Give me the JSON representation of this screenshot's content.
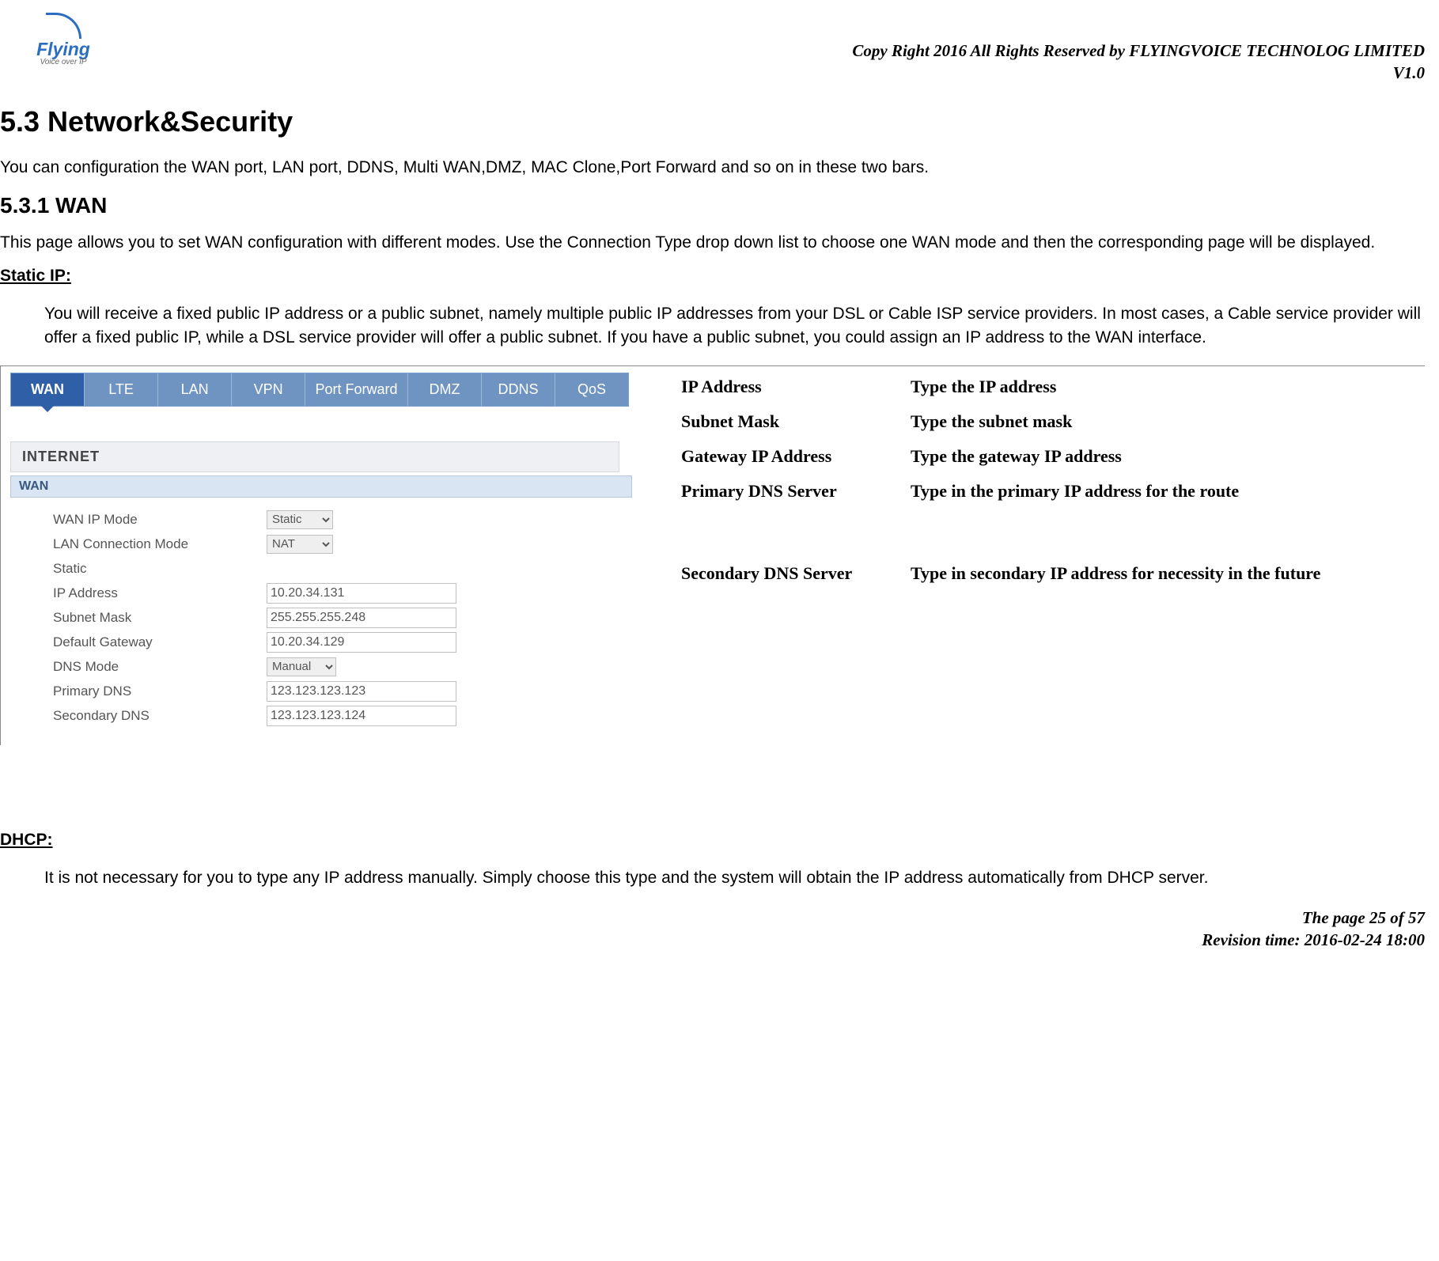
{
  "header": {
    "logo_main": "Flying",
    "logo_sub": "Voice over IP",
    "copyright": "Copy Right 2016 All Rights Reserved by FLYINGVOICE TECHNOLOG LIMITED",
    "version": "V1.0"
  },
  "section": {
    "number_title": "5.3 Network&Security",
    "intro": "You can configuration the WAN port, LAN port, DDNS, Multi WAN,DMZ, MAC Clone,Port Forward and so on in these two bars.",
    "sub_title": "5.3.1 WAN",
    "sub_intro": "This page allows you to set WAN configuration with different modes. Use the Connection Type drop down list to choose one WAN mode and then the corresponding page will be displayed."
  },
  "static_ip": {
    "heading": "Static IP:",
    "description": "You will receive a fixed public IP address or a public subnet, namely multiple public IP addresses from your DSL or Cable ISP service providers. In most cases, a Cable service provider will offer a fixed public IP, while a DSL service provider will offer a public subnet. If you have a public subnet, you could assign an IP address to the WAN interface."
  },
  "tabs": [
    "WAN",
    "LTE",
    "LAN",
    "VPN",
    "Port Forward",
    "DMZ",
    "DDNS",
    "QoS"
  ],
  "panel": {
    "internet": "INTERNET",
    "wan": "WAN"
  },
  "form": {
    "wan_ip_mode_label": "WAN IP Mode",
    "wan_ip_mode_value": "Static",
    "lan_conn_mode_label": "LAN Connection Mode",
    "lan_conn_mode_value": "NAT",
    "static_label": "Static",
    "ip_address_label": "IP Address",
    "ip_address_value": "10.20.34.131",
    "subnet_mask_label": "Subnet Mask",
    "subnet_mask_value": "255.255.255.248",
    "default_gateway_label": "Default Gateway",
    "default_gateway_value": "10.20.34.129",
    "dns_mode_label": "DNS Mode",
    "dns_mode_value": "Manual",
    "primary_dns_label": "Primary DNS",
    "primary_dns_value": "123.123.123.123",
    "secondary_dns_label": "Secondary DNS",
    "secondary_dns_value": "123.123.123.124"
  },
  "desc": {
    "ip_address_l": "IP Address",
    "ip_address_v": "Type the IP address",
    "subnet_mask_l": "Subnet Mask",
    "subnet_mask_v": "Type the subnet mask",
    "gateway_l": "Gateway IP Address",
    "gateway_v": "Type the gateway IP address",
    "primary_dns_l": "Primary DNS Server",
    "primary_dns_v": "Type in the primary IP address for the route",
    "secondary_dns_l": "Secondary DNS Server",
    "secondary_dns_v": "Type in secondary IP address for necessity in the future"
  },
  "dhcp": {
    "heading": "DHCP:",
    "description": "It is not necessary for you to type any IP address manually. Simply choose this type and the system will obtain the IP address automatically from DHCP server."
  },
  "footer": {
    "page": "The page 25 of 57",
    "revision": "Revision time: 2016-02-24 18:00"
  }
}
